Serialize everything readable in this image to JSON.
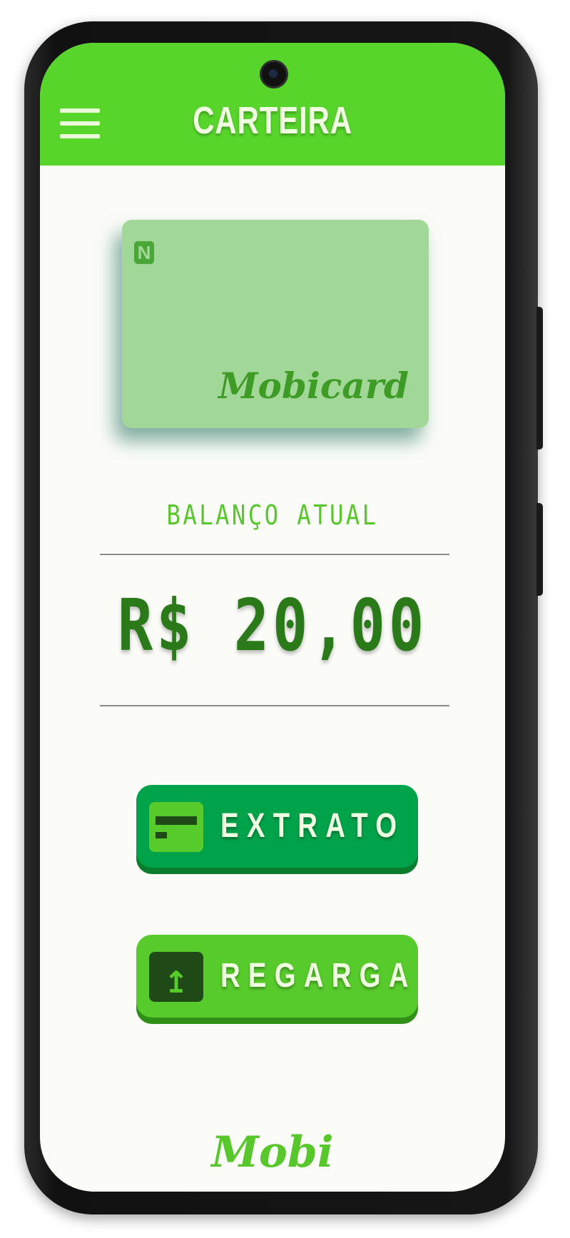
{
  "header": {
    "title": "CARTEIRA",
    "menu_icon": "hamburger-menu-icon",
    "color": "#57d52b"
  },
  "card": {
    "nfc_icon": "nfc-icon",
    "nfc_glyph": "N",
    "brand": "Mobicard",
    "color": "#a1d897"
  },
  "balance": {
    "label": "BALANÇO ATUAL",
    "value": "R$ 20,00"
  },
  "actions": {
    "extrato": {
      "label": "EXTRATO",
      "icon": "credit-card-icon",
      "color": "#00a24a"
    },
    "regarga": {
      "label": "REGARGA",
      "icon": "upload-icon",
      "color": "#57cb2b"
    }
  },
  "footer": {
    "logo": "Mobi"
  }
}
